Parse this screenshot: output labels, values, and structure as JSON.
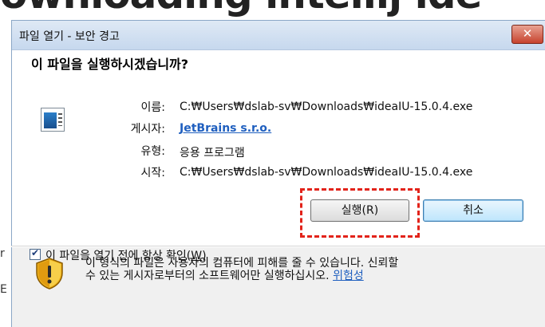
{
  "background": {
    "heading_fragment": "ownloading intellij ide",
    "left_glyphs": [
      "r",
      "E"
    ]
  },
  "dialog": {
    "title": "파일 열기 - 보안 경고",
    "close_label": "✕",
    "question": "이 파일을 실행하시겠습니까?",
    "icon": "application-window-icon",
    "fields": [
      {
        "label": "이름:",
        "value": "C:₩Users₩dslab-sv₩Downloads₩ideaIU-15.0.4.exe"
      },
      {
        "label": "게시자:",
        "value": "JetBrains s.r.o."
      },
      {
        "label": "유형:",
        "value": "응용 프로그램"
      },
      {
        "label": "시작:",
        "value": "C:₩Users₩dslab-sv₩Downloads₩ideaIU-15.0.4.exe"
      }
    ],
    "run_button": "실행(R)",
    "cancel_button": "취소",
    "always_check": {
      "checked": true,
      "label_prefix": "이 파일을 열기 전에 항상 확인(",
      "label_key": "W",
      "label_suffix": ")"
    },
    "warning": {
      "icon": "shield-warning-icon",
      "line1": "이 형식의 파일은 사용자의 컴퓨터에 피해를 줄 수 있습니다. 신뢰할",
      "line2": "수 있는 게시자로부터의 소프트웨어만 실행하십시오. ",
      "risk_link": "위험성"
    },
    "highlight_color": "#e2231a",
    "accent_link_color": "#1f5fbf"
  }
}
